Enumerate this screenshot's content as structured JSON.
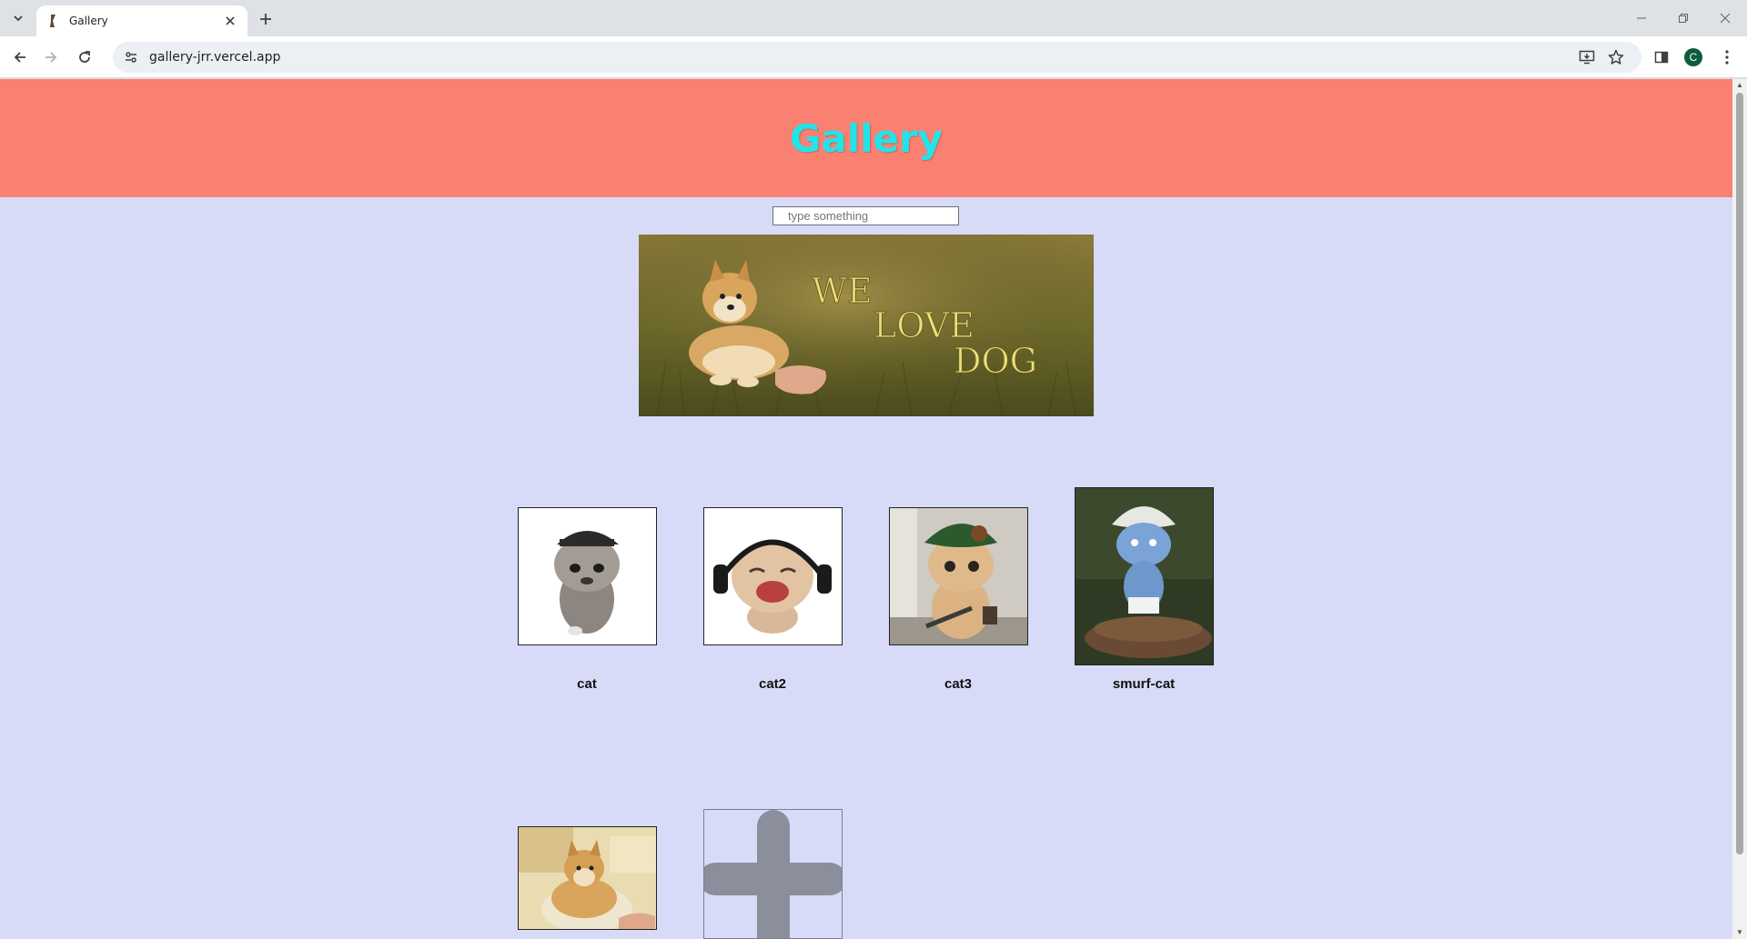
{
  "browser": {
    "tab_title": "Gallery",
    "url": "gallery-jrr.vercel.app",
    "profile_initial": "C"
  },
  "page": {
    "title": "Gallery",
    "search_placeholder": "type something",
    "banner_text": [
      "WE",
      "LOVE",
      "DOG"
    ],
    "items": [
      {
        "caption": "cat"
      },
      {
        "caption": "cat2"
      },
      {
        "caption": "cat3"
      },
      {
        "caption": "smurf-cat"
      }
    ]
  },
  "colors": {
    "header_bg": "#fa8072",
    "title_color": "#22e4e8",
    "page_bg": "#d8dbf8"
  }
}
